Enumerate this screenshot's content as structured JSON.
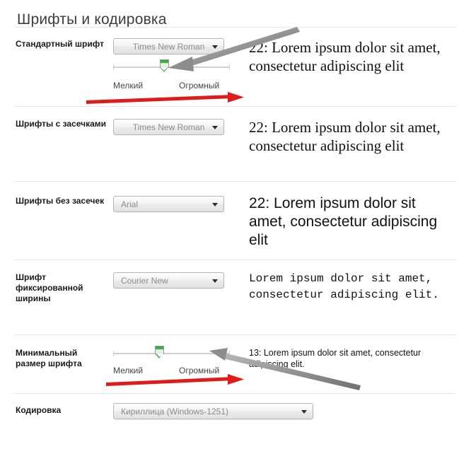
{
  "page": {
    "title": "Шрифты и кодировка"
  },
  "colors": {
    "accent_green": "#43c14e",
    "red_arrow": "#e01b1b",
    "grey_arrow": "#8d8d8d",
    "divider": "#e6e6e6",
    "label_text": "#1a1a1a",
    "select_text": "#8a8a8a"
  },
  "sections": [
    {
      "id": "standard-font",
      "label": "Стандартный шрифт",
      "select": {
        "value": "Times New Roman",
        "options": [
          "Times New Roman"
        ]
      },
      "slider": {
        "value_label": "22",
        "min_label": "Мелкий",
        "max_label": "Огромный",
        "position_percent": 44
      },
      "preview": "22: Lorem ipsum dolor sit amet, consectetur adipiscing elit"
    },
    {
      "id": "serif-font",
      "label": "Шрифты с засечками",
      "select": {
        "value": "Times New Roman",
        "options": [
          "Times New Roman"
        ]
      },
      "preview": "22: Lorem ipsum dolor sit amet, consectetur adipiscing elit"
    },
    {
      "id": "sans-serif-font",
      "label": "Шрифты без засечек",
      "select": {
        "value": "Arial",
        "options": [
          "Arial"
        ]
      },
      "preview": "22: Lorem ipsum dolor sit amet, consectetur adipiscing elit"
    },
    {
      "id": "fixed-width-font",
      "label": "Шрифт фиксированной ширины",
      "select": {
        "value": "Courier New",
        "options": [
          "Courier New"
        ]
      },
      "preview": "Lorem ipsum dolor sit amet, consectetur adipiscing elit."
    },
    {
      "id": "minimum-font-size",
      "label": "Минимальный размер шрифта",
      "slider": {
        "value_label": "13",
        "min_label": "Мелкий",
        "max_label": "Огромный",
        "position_percent": 40
      },
      "preview": "13: Lorem ipsum dolor sit amet, consectetur adipiscing elit."
    },
    {
      "id": "encoding",
      "label": "Кодировка",
      "select": {
        "value": "Кириллица (Windows-1251)",
        "options": [
          "Кириллица (Windows-1251)"
        ]
      }
    }
  ],
  "annotations": {
    "grey_arrow_top": "grey-arrow-pointing-to-standard-font-slider",
    "grey_arrow_bottom": "grey-arrow-pointing-to-minimum-size-slider",
    "red_arrow_top": "red-underline-arrow-under-standard-font-slider",
    "red_arrow_bottom": "red-underline-arrow-under-minimum-size-slider"
  }
}
